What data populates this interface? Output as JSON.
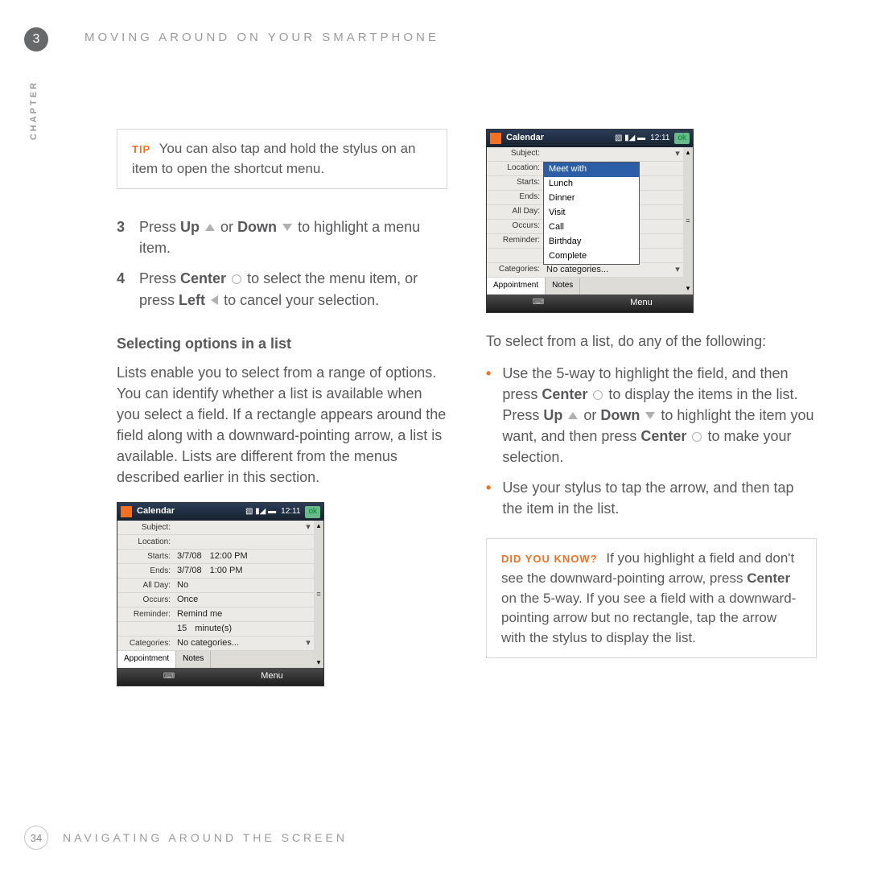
{
  "chapter_number": "3",
  "header": "MOVING AROUND ON YOUR SMARTPHONE",
  "side_label": "CHAPTER",
  "tip": {
    "label": "TIP",
    "text": "You can also tap and hold the stylus on an item to open the shortcut menu."
  },
  "steps": {
    "s3": {
      "num": "3",
      "pre": "Press ",
      "b_up": "Up",
      "mid": " or ",
      "b_down": "Down",
      "post": " to highlight a menu item."
    },
    "s4": {
      "num": "4",
      "pre": "Press ",
      "b_center": "Center",
      "mid": " to select the menu item, or press ",
      "b_left": "Left",
      "post": " to cancel your selection."
    }
  },
  "heading_list": "Selecting options in a list",
  "para_list": "Lists enable you to select from a range of options. You can identify whether a list is available when you select a field. If a rectangle appears around the field along with a downward-pointing arrow, a list is available. Lists are different from the menus described earlier in this section.",
  "right_intro": "To select from a list, do any of the following:",
  "bullets": {
    "b1a": "Use the 5-way to highlight the field, and then press ",
    "b1_center1": "Center",
    "b1b": " to display the items in the list. Press ",
    "b1_up": "Up",
    "b1c": " or ",
    "b1_down": "Down",
    "b1d": " to highlight the item you want, and then press ",
    "b1_center2": "Center",
    "b1e": " to make your selection.",
    "b2": "Use your stylus to tap the arrow, and then tap the item in the list."
  },
  "dyk": {
    "label": "DID YOU KNOW?",
    "t1": "If you highlight a field and don't see the downward-pointing arrow, press ",
    "b_center": "Center",
    "t2": " on the 5-way. If you see a field with a downward-pointing arrow but no rectangle, tap the arrow with the stylus to display the list."
  },
  "footer": {
    "page": "34",
    "text": "NAVIGATING AROUND THE SCREEN"
  },
  "phone_common": {
    "title": "Calendar",
    "time": "12:11",
    "ok": "ok",
    "tab1": "Appointment",
    "tab2": "Notes",
    "menu": "Menu",
    "labels": {
      "subject": "Subject:",
      "location": "Location:",
      "starts": "Starts:",
      "ends": "Ends:",
      "allday": "All Day:",
      "occurs": "Occurs:",
      "reminder": "Reminder:",
      "reminder_time": "15",
      "reminder_unit": "minute(s)",
      "categories": "Categories:",
      "no_categories": "No categories..."
    }
  },
  "phone1": {
    "starts_date": "3/7/08",
    "starts_time": "12:00 PM",
    "ends_date": "3/7/08",
    "ends_time": "1:00 PM",
    "allday": "No",
    "occurs": "Once",
    "reminder": "Remind me"
  },
  "phone2_dropdown": [
    "Meet with",
    "Lunch",
    "Dinner",
    "Visit",
    "Call",
    "Birthday",
    "Complete"
  ]
}
